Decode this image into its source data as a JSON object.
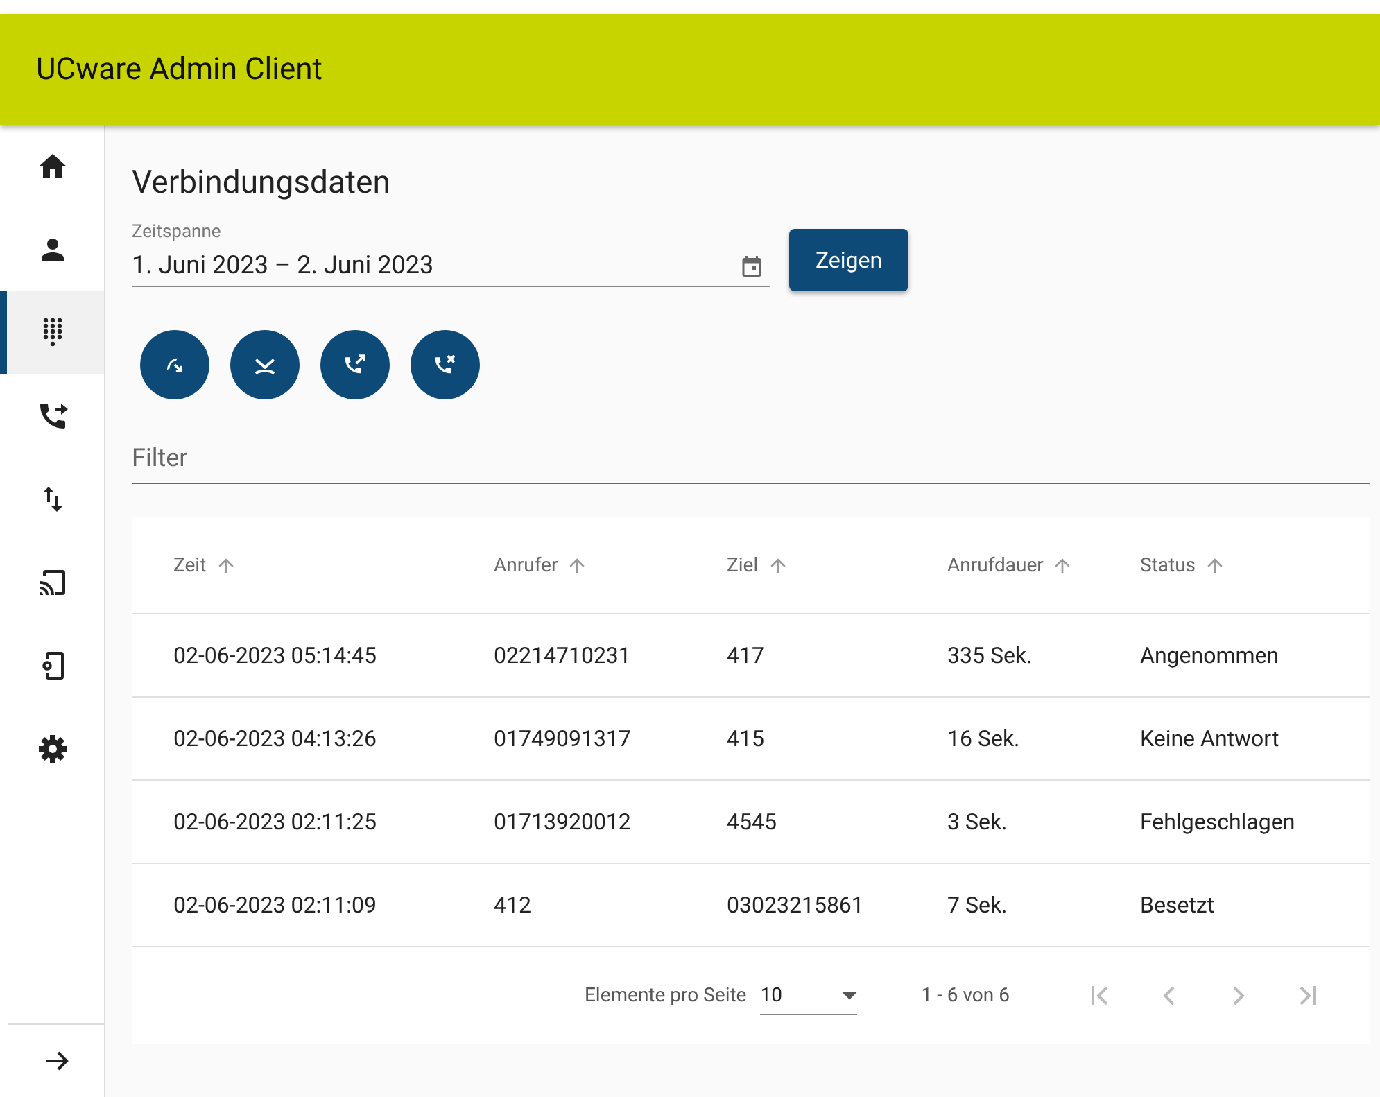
{
  "app_bar": {
    "title": "UCware Admin Client"
  },
  "sidebar": {
    "items": [
      {
        "selected": false
      },
      {
        "selected": false
      },
      {
        "selected": true
      },
      {
        "selected": false
      },
      {
        "selected": false
      },
      {
        "selected": false
      },
      {
        "selected": false
      },
      {
        "selected": false
      }
    ]
  },
  "page": {
    "title": "Verbindungsdaten",
    "date_range": {
      "label": "Zeitspanne",
      "value": "1. Juni 2023 – 2. Juni 2023"
    },
    "show_button": "Zeigen",
    "call_filters": [
      {
        "kind": "incoming"
      },
      {
        "kind": "missed"
      },
      {
        "kind": "outgoing"
      },
      {
        "kind": "failed"
      }
    ],
    "filter": {
      "placeholder": "Filter"
    },
    "table": {
      "columns": [
        "Zeit",
        "Anrufer",
        "Ziel",
        "Anrufdauer",
        "Status"
      ],
      "rows": [
        [
          "02-06-2023 05:14:45",
          "02214710231",
          "417",
          "335 Sek.",
          "Angenommen"
        ],
        [
          "02-06-2023 04:13:26",
          "01749091317",
          "415",
          "16 Sek.",
          "Keine Antwort"
        ],
        [
          "02-06-2023 02:11:25",
          "01713920012",
          "4545",
          "3 Sek.",
          "Fehlgeschlagen"
        ],
        [
          "02-06-2023 02:11:09",
          "412",
          "03023215861",
          "7 Sek.",
          "Besetzt"
        ]
      ]
    },
    "paginator": {
      "page_size_label": "Elemente pro Seite",
      "page_size": "10",
      "range": "1 - 6 von 6",
      "nav": [
        {
          "kind": "first",
          "disabled": true
        },
        {
          "kind": "prev",
          "disabled": true
        },
        {
          "kind": "next",
          "disabled": true
        },
        {
          "kind": "last",
          "disabled": true
        }
      ]
    }
  }
}
